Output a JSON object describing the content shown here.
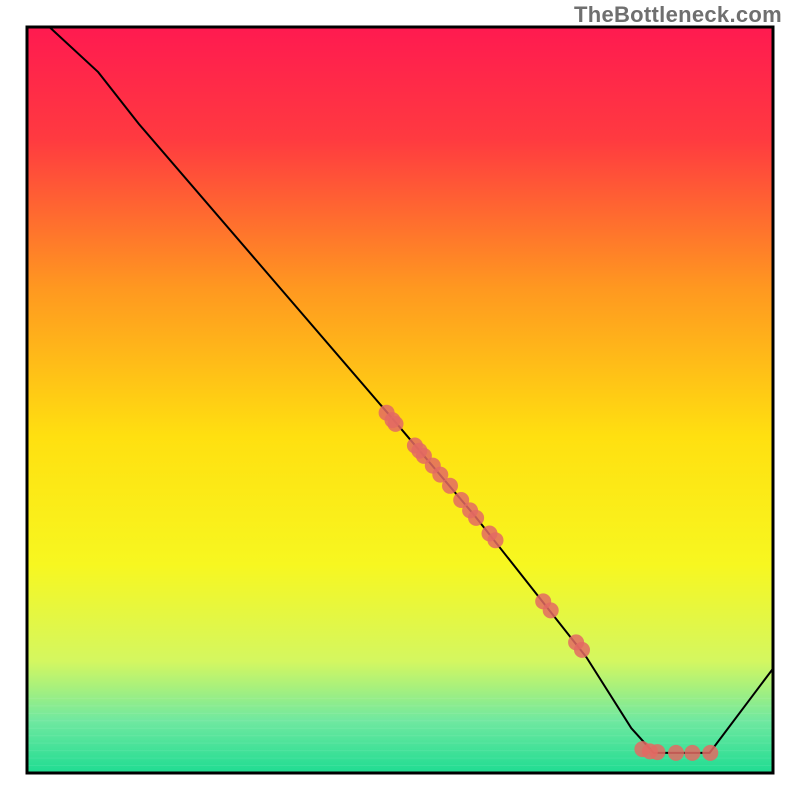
{
  "watermark": "TheBottleneck.com",
  "chart_data": {
    "type": "line",
    "title": "",
    "xlabel": "",
    "ylabel": "",
    "xlim": [
      0,
      100
    ],
    "ylim": [
      0,
      100
    ],
    "background": {
      "type": "vertical-gradient",
      "stops": [
        {
          "offset": 0.0,
          "color": "#ff1a50"
        },
        {
          "offset": 0.15,
          "color": "#ff3a40"
        },
        {
          "offset": 0.35,
          "color": "#ff9820"
        },
        {
          "offset": 0.55,
          "color": "#ffe010"
        },
        {
          "offset": 0.72,
          "color": "#f7f720"
        },
        {
          "offset": 0.85,
          "color": "#d4f760"
        },
        {
          "offset": 0.93,
          "color": "#70e8a0"
        },
        {
          "offset": 1.0,
          "color": "#1fdc92"
        }
      ]
    },
    "series": [
      {
        "name": "curve",
        "color": "#000000",
        "width": 2,
        "points": [
          {
            "x": 3.0,
            "y": 100.0
          },
          {
            "x": 9.5,
            "y": 94.0
          },
          {
            "x": 15.0,
            "y": 87.0
          },
          {
            "x": 49.0,
            "y": 47.5
          },
          {
            "x": 60.0,
            "y": 34.5
          },
          {
            "x": 75.0,
            "y": 15.5
          },
          {
            "x": 81.0,
            "y": 6.0
          },
          {
            "x": 84.0,
            "y": 2.7
          },
          {
            "x": 91.5,
            "y": 2.7
          },
          {
            "x": 100.0,
            "y": 14.0
          }
        ]
      }
    ],
    "scatter": {
      "name": "dots",
      "color": "#e36a63",
      "radius": 8,
      "points": [
        {
          "x": 48.2,
          "y": 48.3
        },
        {
          "x": 49.0,
          "y": 47.3
        },
        {
          "x": 49.4,
          "y": 46.8
        },
        {
          "x": 52.0,
          "y": 43.9
        },
        {
          "x": 52.6,
          "y": 43.2
        },
        {
          "x": 53.2,
          "y": 42.5
        },
        {
          "x": 54.4,
          "y": 41.2
        },
        {
          "x": 55.4,
          "y": 40.0
        },
        {
          "x": 56.7,
          "y": 38.5
        },
        {
          "x": 58.2,
          "y": 36.6
        },
        {
          "x": 59.4,
          "y": 35.2
        },
        {
          "x": 60.2,
          "y": 34.2
        },
        {
          "x": 62.0,
          "y": 32.1
        },
        {
          "x": 62.8,
          "y": 31.2
        },
        {
          "x": 69.2,
          "y": 23.0
        },
        {
          "x": 70.2,
          "y": 21.8
        },
        {
          "x": 73.6,
          "y": 17.5
        },
        {
          "x": 74.4,
          "y": 16.5
        },
        {
          "x": 82.5,
          "y": 3.2
        },
        {
          "x": 83.5,
          "y": 2.9
        },
        {
          "x": 84.5,
          "y": 2.8
        },
        {
          "x": 87.0,
          "y": 2.7
        },
        {
          "x": 89.2,
          "y": 2.7
        },
        {
          "x": 91.6,
          "y": 2.7
        }
      ]
    }
  }
}
